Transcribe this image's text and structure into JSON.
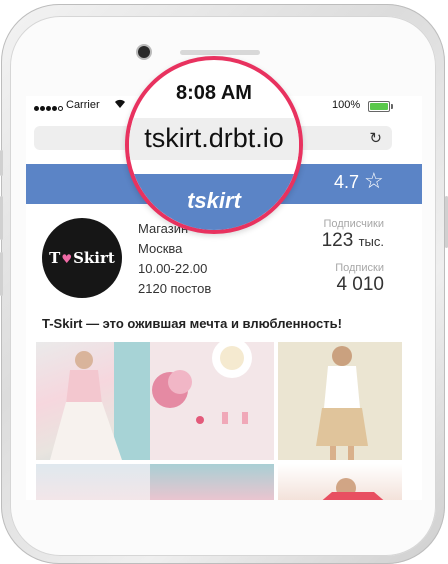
{
  "status_bar": {
    "carrier": "Carrier",
    "time": "8:08 AM",
    "battery_percent": "100%",
    "battery_level": 1.0
  },
  "browser": {
    "url": "tskirt.drbt.io",
    "reload_icon": "reload-icon"
  },
  "header": {
    "brand": "tskirt",
    "rating": "4.7",
    "star_icon": "star-outline-icon",
    "color": "#5b84c6"
  },
  "profile": {
    "avatar_text_left": "T",
    "avatar_text_right": "Skirt",
    "avatar_heart": "♥",
    "info": [
      "Магазин",
      "Москва",
      "10.00-22.00",
      "2120 постов"
    ],
    "followers_label": "Подписчики",
    "followers_value": "123",
    "followers_unit": "тыс.",
    "following_label": "Подписки",
    "following_value": "4 010"
  },
  "tagline": "T-Skirt — это ожившая мечта и влюбленность!",
  "accent": "#e8325f"
}
